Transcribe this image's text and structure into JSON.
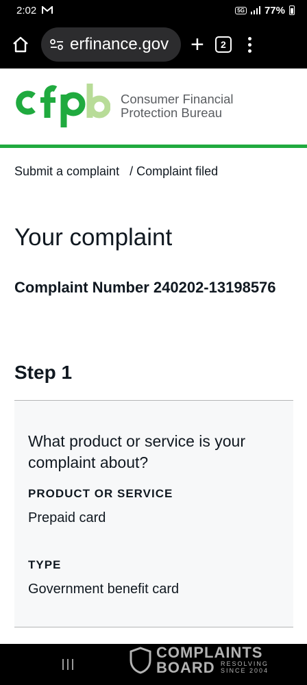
{
  "status_bar": {
    "time": "2:02",
    "left_icon": "gmail-icon",
    "network": "5G",
    "battery": "77%"
  },
  "browser": {
    "url": "erfinance.gov",
    "tab_count": "2",
    "icons": [
      "home-icon",
      "site-settings-icon",
      "plus-icon",
      "tabs-icon",
      "menu-icon"
    ]
  },
  "site": {
    "logo_mark": "cfpb",
    "logo_line1": "Consumer Financial",
    "logo_line2": "Protection Bureau",
    "accent_color": "#20aa3f"
  },
  "breadcrumb": {
    "link": "Submit a complaint",
    "separator": "/",
    "current": "Complaint filed"
  },
  "page": {
    "title": "Your complaint",
    "complaint_number": "Complaint Number 240202-13198576"
  },
  "step1": {
    "title": "Step 1",
    "question": "What product or service is your complaint about?",
    "fields": [
      {
        "label": "PRODUCT OR SERVICE",
        "value": "Prepaid card"
      },
      {
        "label": "TYPE",
        "value": "Government benefit card"
      }
    ]
  },
  "watermark": {
    "line1": "COMPLAINTS",
    "line2": "BOARD",
    "tag1": "RESOLVING",
    "tag2": "SINCE 2004"
  }
}
